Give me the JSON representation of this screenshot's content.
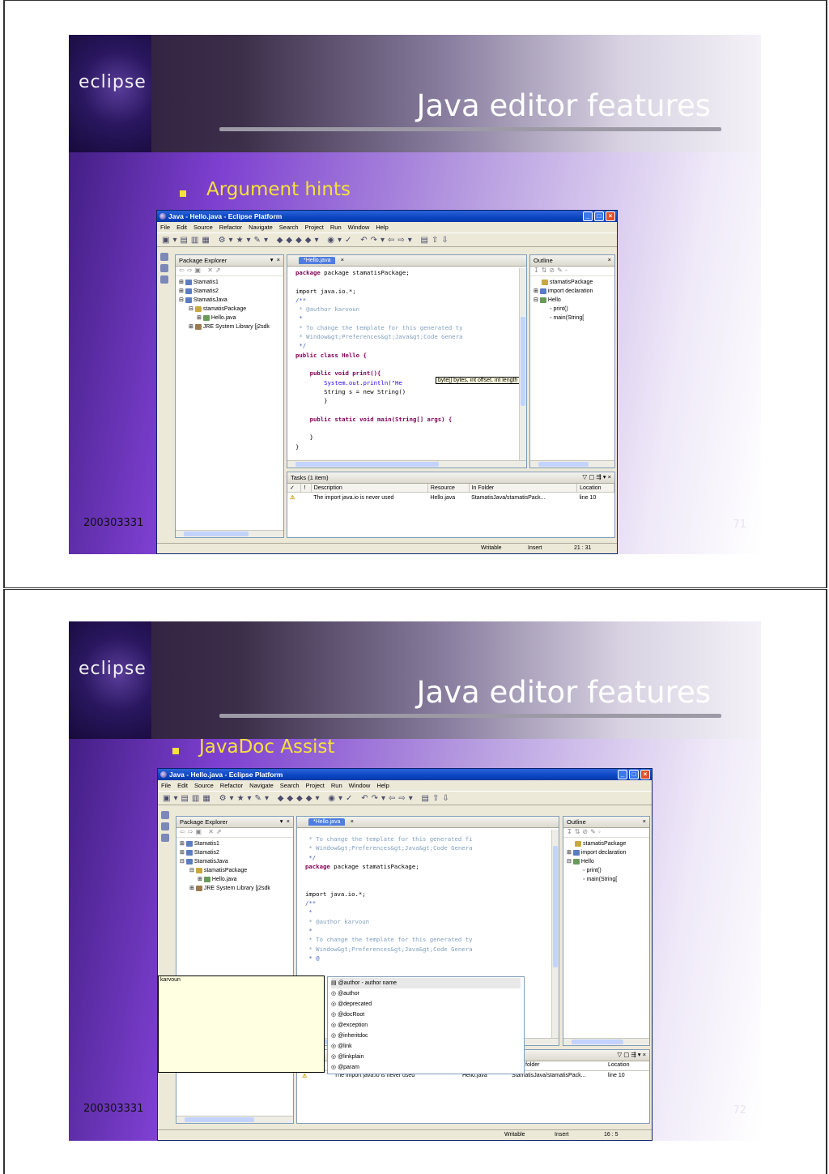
{
  "slides": [
    {
      "logo": "eclipse",
      "title": "Java editor features",
      "bullet": "Argument hints",
      "code_id": "200303331",
      "page_number": "71",
      "window": {
        "title": "Java - Hello.java - Eclipse Platform",
        "menu": [
          "File",
          "Edit",
          "Source",
          "Refactor",
          "Navigate",
          "Search",
          "Project",
          "Run",
          "Window",
          "Help"
        ],
        "package_explorer": {
          "title": "Package Explorer",
          "tree": [
            "Stamatis1",
            "Stamatis2",
            "StamatisJava",
            "stamatisPackage",
            "Hello.java",
            "JRE System Library [j2sdk"
          ]
        },
        "editor_tab": "*Hello.java",
        "code_lines": [
          "package stamatisPackage;",
          "",
          "import java.io.*;",
          "/**",
          " * @author karvoun",
          " *",
          " * To change the template for this generated ty",
          " * Window&gt;Preferences&gt;Java&gt;Code Genera",
          " */",
          "public class Hello {",
          "",
          "    public void print(){",
          "        System.out.println(\"He",
          "        String s = new String()",
          "        }",
          "",
          "    public static void main(String[] args) {",
          "",
          "    }",
          "}"
        ],
        "hint": "byte[] bytes, int offset, int length",
        "outline": {
          "title": "Outline",
          "tree": [
            "stamatisPackage",
            "import declaration",
            "Hello",
            "print()",
            "main(String["
          ]
        },
        "tasks": {
          "title": "Tasks (1 item)",
          "columns": [
            "✓",
            "!",
            "Description",
            "Resource",
            "In Folder",
            "Location"
          ],
          "rows": [
            [
              "",
              "",
              "The import java.io is never used",
              "Hello.java",
              "StamatisJava/stamatisPack...",
              "line 10"
            ]
          ]
        },
        "status": [
          "Writable",
          "Insert",
          "21 : 31"
        ]
      }
    },
    {
      "logo": "eclipse",
      "title": "Java editor features",
      "bullet": "JavaDoc Assist",
      "code_id": "200303331",
      "page_number": "72",
      "window": {
        "title": "Java - Hello.java - Eclipse Platform",
        "menu": [
          "File",
          "Edit",
          "Source",
          "Refactor",
          "Navigate",
          "Search",
          "Project",
          "Run",
          "Window",
          "Help"
        ],
        "package_explorer": {
          "title": "Package Explorer",
          "tree": [
            "Stamatis1",
            "Stamatis2",
            "StamatisJava",
            "stamatisPackage",
            "Hello.java",
            "JRE System Library [j2sdk"
          ]
        },
        "editor_tab": "*Hello.java",
        "code_lines": [
          " * To change the template for this generated fi",
          " * Window&gt;Preferences&gt;Java&gt;Code Genera",
          " */",
          "package stamatisPackage;",
          "",
          "",
          "import java.io.*;",
          "/**",
          " *",
          " * @author karvoun",
          " *",
          " * To change the template for this generated ty",
          " * Window&gt;Preferences&gt;Java&gt;Code Genera",
          " * @"
        ],
        "assist_doc": "karvoun",
        "assist_items": [
          "@author - author name",
          "@author",
          "@deprecated",
          "@docRoot",
          "@exception",
          "@inheritdoc",
          "@link",
          "@linkplain",
          "@param"
        ],
        "outline": {
          "title": "Outline",
          "tree": [
            "stamatisPackage",
            "import declaration",
            "Hello",
            "print()",
            "main(String["
          ]
        },
        "tasks": {
          "columns": [
            "folder",
            "Location"
          ],
          "rows": [
            [
              "",
              "",
              "The import java.io is never used",
              "Hello.java",
              "StamatisJava/stamatisPack...",
              "line 10"
            ]
          ]
        },
        "status": [
          "Writable",
          "Insert",
          "16 : 5"
        ]
      }
    }
  ]
}
